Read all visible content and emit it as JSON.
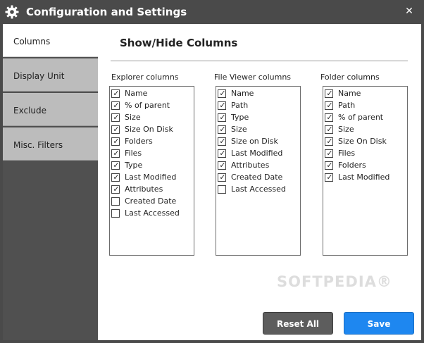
{
  "window": {
    "title": "Configuration and Settings",
    "close_glyph": "✕"
  },
  "sidebar": {
    "items": [
      {
        "label": "Columns",
        "active": true
      },
      {
        "label": "Display Unit",
        "active": false
      },
      {
        "label": "Exclude",
        "active": false
      },
      {
        "label": "Misc. Filters",
        "active": false
      }
    ]
  },
  "main": {
    "heading": "Show/Hide Columns",
    "explorer": {
      "title": "Explorer columns",
      "items": [
        {
          "label": "Name",
          "checked": true
        },
        {
          "label": "% of parent",
          "checked": true
        },
        {
          "label": "Size",
          "checked": true
        },
        {
          "label": "Size On Disk",
          "checked": true
        },
        {
          "label": "Folders",
          "checked": true
        },
        {
          "label": "Files",
          "checked": true
        },
        {
          "label": "Type",
          "checked": true
        },
        {
          "label": "Last Modified",
          "checked": true
        },
        {
          "label": "Attributes",
          "checked": true
        },
        {
          "label": "Created Date",
          "checked": false
        },
        {
          "label": "Last Accessed",
          "checked": false
        }
      ]
    },
    "file_viewer": {
      "title": "File Viewer columns",
      "items": [
        {
          "label": "Name",
          "checked": true
        },
        {
          "label": "Path",
          "checked": true
        },
        {
          "label": "Type",
          "checked": true
        },
        {
          "label": "Size",
          "checked": true
        },
        {
          "label": "Size on Disk",
          "checked": true
        },
        {
          "label": "Last Modified",
          "checked": true
        },
        {
          "label": "Attributes",
          "checked": true
        },
        {
          "label": "Created Date",
          "checked": true
        },
        {
          "label": "Last Accessed",
          "checked": false
        }
      ]
    },
    "folder": {
      "title": "Folder columns",
      "items": [
        {
          "label": "Name",
          "checked": true
        },
        {
          "label": "Path",
          "checked": true
        },
        {
          "label": "% of parent",
          "checked": true
        },
        {
          "label": "Size",
          "checked": true
        },
        {
          "label": "Size On Disk",
          "checked": true
        },
        {
          "label": "Files",
          "checked": true
        },
        {
          "label": "Folders",
          "checked": true
        },
        {
          "label": "Last Modified",
          "checked": true
        }
      ]
    }
  },
  "buttons": {
    "reset_label": "Reset All",
    "save_label": "Save"
  },
  "watermark": "SOFTPEDIA®",
  "colors": {
    "title_bar": "#4a4a4a",
    "sidebar_inactive": "#bcbcbc",
    "sidebar_active": "#ffffff",
    "save_button": "#1e87f0",
    "reset_button": "#5d5d5d"
  },
  "icons": {
    "title": "gear-icon",
    "close": "close-icon",
    "checkbox_checked": "checkmark-icon"
  }
}
